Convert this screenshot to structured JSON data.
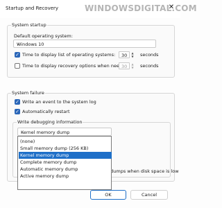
{
  "window": {
    "title": "Startup and Recovery",
    "watermark": "WINDOWSDIGITAL.COM"
  },
  "system_startup": {
    "group_label": "System startup",
    "default_os_label": "Default operating system:",
    "default_os_value": "Windows 10",
    "time_list_label": "Time to display list of operating systems:",
    "time_list_checked": true,
    "time_list_value": "30",
    "time_list_unit": "seconds",
    "time_recovery_label": "Time to display recovery options when needed:",
    "time_recovery_checked": false,
    "time_recovery_value": "30",
    "time_recovery_unit": "seconds"
  },
  "system_failure": {
    "group_label": "System failure",
    "write_event_label": "Write an event to the system log",
    "write_event_checked": true,
    "auto_restart_label": "Automatically restart",
    "auto_restart_checked": true,
    "debug_label": "Write debugging information",
    "debug_selected": "Kernel memory dump",
    "debug_options": [
      "(none)",
      "Small memory dump (256 KB)",
      "Kernel memory dump",
      "Complete memory dump",
      "Automatic memory dump",
      "Active memory dump"
    ],
    "disable_auto_delete_label": "Disable automatic deletion of memory dumps when disk space is low"
  },
  "buttons": {
    "ok": "OK",
    "cancel": "Cancel"
  }
}
